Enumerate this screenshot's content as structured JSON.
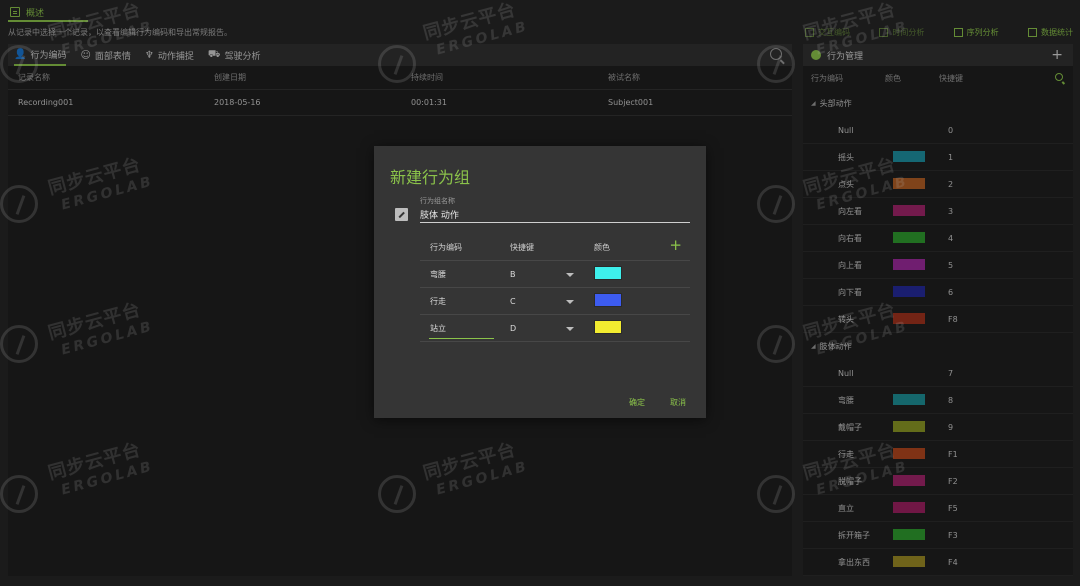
{
  "top_tab": {
    "label": "概述"
  },
  "description": "从记录中选择一个记录，以查看编辑行为编码和导出常规报告。",
  "subtabs": [
    {
      "label": "行为编码",
      "icon": "person-icon"
    },
    {
      "label": "面部表情",
      "icon": "face-icon"
    },
    {
      "label": "动作捕捉",
      "icon": "running-icon"
    },
    {
      "label": "驾驶分析",
      "icon": "car-icon"
    }
  ],
  "records": {
    "headers": [
      "记录名称",
      "创建日期",
      "持续时间",
      "被试名称"
    ],
    "rows": [
      [
        "Recording001",
        "2018-05-16",
        "00:01:31",
        "Subject001"
      ]
    ]
  },
  "right_toolbar": [
    {
      "label": "交互编码",
      "state": "dim"
    },
    {
      "label": "时间分析",
      "state": "dim"
    },
    {
      "label": "序列分析",
      "state": "on"
    },
    {
      "label": "数据统计",
      "state": "on"
    }
  ],
  "behavior_panel": {
    "title": "行为管理",
    "columns": [
      "行为编码",
      "颜色",
      "快捷键"
    ],
    "groups": [
      {
        "name": "头部动作",
        "items": [
          {
            "name": "Null",
            "color": "",
            "key": "0"
          },
          {
            "name": "摇头",
            "color": "#1e8fa0",
            "key": "1"
          },
          {
            "name": "点头",
            "color": "#b05e25",
            "key": "2"
          },
          {
            "name": "向左看",
            "color": "#a0246a",
            "key": "3"
          },
          {
            "name": "向右看",
            "color": "#2e9a2e",
            "key": "4"
          },
          {
            "name": "向上看",
            "color": "#9c2a9c",
            "key": "5"
          },
          {
            "name": "向下看",
            "color": "#242a9a",
            "key": "6"
          },
          {
            "name": "转头",
            "color": "#a0321e",
            "key": "F8"
          }
        ]
      },
      {
        "name": "肢体动作",
        "items": [
          {
            "name": "Null",
            "color": "",
            "key": "7"
          },
          {
            "name": "弯腰",
            "color": "#1e8f96",
            "key": "8"
          },
          {
            "name": "戴帽子",
            "color": "#8a9624",
            "key": "9"
          },
          {
            "name": "行走",
            "color": "#b0461e",
            "key": "F1"
          },
          {
            "name": "脱帽子",
            "color": "#a0246a",
            "key": "F2"
          },
          {
            "name": "直立",
            "color": "#9c2060",
            "key": "F5"
          },
          {
            "name": "拆开箱子",
            "color": "#2e9a2e",
            "key": "F3"
          },
          {
            "name": "拿出东西",
            "color": "#9a8a24",
            "key": "F4"
          }
        ]
      }
    ]
  },
  "dialog": {
    "title": "新建行为组",
    "name_label": "行为组名称",
    "name_value": "肢体 动作",
    "table_headers": [
      "行为编码",
      "快捷键",
      "颜色"
    ],
    "rows": [
      {
        "name": "弯腰",
        "key": "B",
        "color": "#3ef0ec"
      },
      {
        "name": "行走",
        "key": "C",
        "color": "#3d5cf0"
      },
      {
        "name": "站立",
        "key": "D",
        "color": "#f2ec30"
      }
    ],
    "ok_label": "确定",
    "cancel_label": "取消"
  },
  "watermark": {
    "cn": "同步云平台",
    "en": "ERGOLAB"
  },
  "colors": {
    "accent": "#8bc34a",
    "background": "#262626",
    "panel": "#1f1f1f",
    "dialog": "#353535"
  }
}
